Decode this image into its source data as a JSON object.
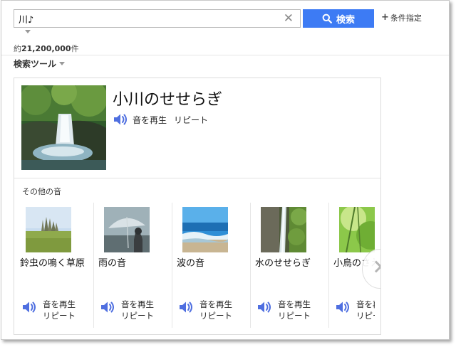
{
  "search": {
    "query": "川♪",
    "button_label": "検索",
    "conditions_label": "条件指定",
    "result_count_prefix": "約",
    "result_count": "21,200,000",
    "result_count_suffix": "件",
    "tools_label": "検索ツール"
  },
  "sound_card": {
    "title": "小川のせせらぎ",
    "play_label": "音を再生",
    "repeat_label": "リピート",
    "others_label": "その他の音",
    "tiles": [
      {
        "title": "鈴虫の鳴く草原",
        "play_label": "音を再生",
        "repeat_label": "リピート"
      },
      {
        "title": "雨の音",
        "play_label": "音を再生",
        "repeat_label": "リピート"
      },
      {
        "title": "波の音",
        "play_label": "音を再生",
        "repeat_label": "リピート"
      },
      {
        "title": "水のせせらぎ",
        "play_label": "音を再生",
        "repeat_label": "リピート"
      },
      {
        "title": "小鳥のさえずり",
        "play_label": "音を再生",
        "repeat_label": "リピート"
      }
    ]
  },
  "colors": {
    "accent": "#3d7bf4",
    "speaker": "#4f6fe0"
  }
}
